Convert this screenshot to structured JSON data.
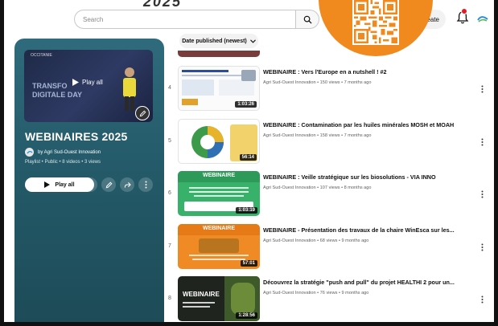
{
  "top_partial": "2025",
  "search": {
    "placeholder": "Search"
  },
  "header": {
    "create_label": "Create"
  },
  "playlist": {
    "hero_play_label": "Play all",
    "hero_banner_top": "OCCITANIE",
    "hero_banner_line1": "TRANSFO",
    "hero_banner_line2": "DIGITALE DAY",
    "title": "WEBINAIRES 2025",
    "owner": "by Agri Sud-Ouest Innovation",
    "meta": "Playlist • Public • 8 videos • 3 views",
    "play_all_label": "Play all"
  },
  "sort": {
    "label": "Date published (newest)"
  },
  "videos": [
    {
      "index": "4",
      "title": "WEBINAIRE : Vers l'Europe en a nutshell ! #2",
      "meta": "Agri Sud-Ouest Innovation • 150 views • 7 months ago",
      "duration": "1:03:26"
    },
    {
      "index": "5",
      "title": "WEBINAIRE : Contamination par les huiles minérales MOSH et MOAH",
      "meta": "Agri Sud-Ouest Innovation • 158 views • 7 months ago",
      "duration": "56:14"
    },
    {
      "index": "6",
      "title": "WEBINAIRE : Veille stratégique sur les biosolutions - VIA INNO",
      "meta": "Agri Sud-Ouest Innovation • 107 views • 8 months ago",
      "duration": "1:03:19",
      "thumb_heading": "WEBINAIRE"
    },
    {
      "index": "7",
      "title": "WEBINAIRE - Présentation des travaux de la chaire WinEsca sur les...",
      "meta": "Agri Sud-Ouest Innovation • 68 views • 9 months ago",
      "duration": "57:01",
      "thumb_heading": "WEBINAIRE"
    },
    {
      "index": "8",
      "title": "Découvrez la stratégie \"push and pull\" du projet HEALTHI 2 pour un...",
      "meta": "Agri Sud-Ouest Innovation • 76 views • 9 months ago",
      "duration": "1:28:56",
      "thumb_heading": "WEBINAIRE"
    }
  ],
  "colors": {
    "accent_orange": "#f0891e",
    "panel_teal": "#2a6171",
    "badge_red": "#e41b23"
  }
}
